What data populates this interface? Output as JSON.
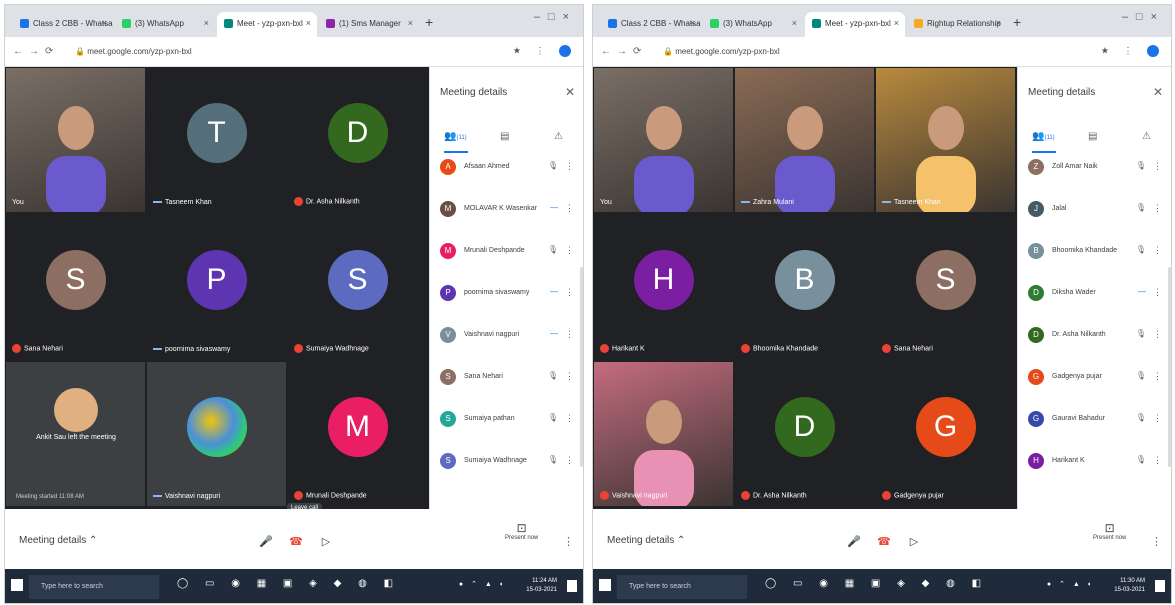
{
  "screens": [
    {
      "id": "left",
      "tabs": [
        {
          "label": "Class 2 CBB - Whatsapp in bl",
          "fav": "#1a73e8",
          "active": false
        },
        {
          "label": "(3) WhatsApp",
          "fav": "#25d366",
          "active": false
        },
        {
          "label": "Meet - yzp-pxn-bxl",
          "fav": "#00897b",
          "active": true
        },
        {
          "label": "(1) Sms Manager",
          "fav": "#8e24aa",
          "active": false
        }
      ],
      "url": "meet.google.com/yzp-pxn-bxl",
      "tiles": [
        {
          "kind": "camera",
          "name": "You",
          "mic": "none",
          "bg": "#7a6f66"
        },
        {
          "kind": "avatar",
          "letter": "T",
          "color": "#546e7a",
          "name": "Tasneem Khan",
          "mic": "on"
        },
        {
          "kind": "avatar",
          "letter": "D",
          "color": "#33691e",
          "name": "Dr. Asha Nilkanth",
          "mic": "off"
        },
        {
          "kind": "avatar",
          "letter": "S",
          "color": "#8d6e63",
          "name": "Sana Nehari",
          "mic": "off"
        },
        {
          "kind": "avatar",
          "letter": "P",
          "color": "#5e35b1",
          "name": "poornima sivaswamy",
          "mic": "on"
        },
        {
          "kind": "avatar",
          "letter": "S",
          "color": "#5c6bc0",
          "name": "Sumaiya Wadhnage",
          "mic": "off"
        },
        {
          "kind": "left",
          "note": "Ankit Sau left the meeting",
          "sub": "Meeting started 11:08 AM",
          "name": "",
          "mic": "on"
        },
        {
          "kind": "image",
          "name": "Vaishnavi nagpuri",
          "mic": "on"
        },
        {
          "kind": "avatar",
          "letter": "M",
          "color": "#e91e63",
          "name": "Mrunali Deshpande",
          "mic": "off"
        }
      ],
      "tooltip": "Leave call",
      "panel": {
        "title": "Meeting details",
        "people_count": "(11)",
        "participants": [
          {
            "name": "Afsaan Ahmed",
            "initial": "A",
            "color": "#e64a19",
            "mic": "off"
          },
          {
            "name": "MOLAVAR K Wasenkar",
            "initial": "M",
            "color": "#6d4c41",
            "mic": "on"
          },
          {
            "name": "Mrunali Deshpande",
            "initial": "M",
            "color": "#e91e63",
            "mic": "off"
          },
          {
            "name": "poornima sivaswamy",
            "initial": "P",
            "color": "#5e35b1",
            "mic": "on"
          },
          {
            "name": "Vaishnavi nagpuri",
            "initial": "V",
            "color": "#78909c",
            "mic": "on"
          },
          {
            "name": "Sana Nehari",
            "initial": "S",
            "color": "#8d6e63",
            "mic": "off"
          },
          {
            "name": "Sumaiya pathan",
            "initial": "S",
            "color": "#26a69a",
            "mic": "off"
          },
          {
            "name": "Sumaiya Wadhnage",
            "initial": "S",
            "color": "#5c6bc0",
            "mic": "off"
          }
        ]
      },
      "bottom": {
        "meeting_details": "Meeting details",
        "present": "Present now"
      },
      "taskbar": {
        "search": "Type here to search",
        "time": "11:24 AM",
        "date": "15-03-2021"
      }
    },
    {
      "id": "right",
      "tabs": [
        {
          "label": "Class 2 CBB - Whatsapp in bl",
          "fav": "#1a73e8",
          "active": false
        },
        {
          "label": "(3) WhatsApp",
          "fav": "#25d366",
          "active": false
        },
        {
          "label": "Meet - yzp-pxn-bxl",
          "fav": "#00897b",
          "active": true
        },
        {
          "label": "Rightup Relationship",
          "fav": "#f9a825",
          "active": false
        }
      ],
      "url": "meet.google.com/yzp-pxn-bxl",
      "tiles": [
        {
          "kind": "camera",
          "name": "You",
          "mic": "none",
          "bg": "#7a6f66"
        },
        {
          "kind": "camera2",
          "name": "Zahra Mulani",
          "mic": "on",
          "bg": "#8a6b55"
        },
        {
          "kind": "camera3",
          "name": "Tasneem Khan",
          "mic": "on",
          "bg": "#b88a3d"
        },
        {
          "kind": "avatar",
          "letter": "H",
          "color": "#7b1fa2",
          "name": "Harikant K",
          "mic": "off"
        },
        {
          "kind": "avatar",
          "letter": "B",
          "color": "#78909c",
          "name": "Bhoomika Khandade",
          "mic": "off"
        },
        {
          "kind": "avatar",
          "letter": "S",
          "color": "#8d6e63",
          "name": "Sana Nehari",
          "mic": "off"
        },
        {
          "kind": "camera4",
          "name": "Vaishnavi nagpuri",
          "mic": "off",
          "bg": "#c46c7f"
        },
        {
          "kind": "avatar",
          "letter": "D",
          "color": "#33691e",
          "name": "Dr. Asha Nilkanth",
          "mic": "off"
        },
        {
          "kind": "avatar",
          "letter": "G",
          "color": "#e64a19",
          "name": "Gadgenya pujar",
          "mic": "off"
        }
      ],
      "tooltip": "",
      "panel": {
        "title": "Meeting details",
        "people_count": "(11)",
        "participants": [
          {
            "name": "Zoll Amar Naik",
            "initial": "Z",
            "color": "#8d6e63",
            "mic": "off"
          },
          {
            "name": "Jalal",
            "initial": "J",
            "color": "#455a64",
            "mic": "off"
          },
          {
            "name": "Bhoomika Khandade",
            "initial": "B",
            "color": "#78909c",
            "mic": "off"
          },
          {
            "name": "Diksha Wader",
            "initial": "D",
            "color": "#2e7d32",
            "mic": "on"
          },
          {
            "name": "Dr. Asha Nilkanth",
            "initial": "D",
            "color": "#33691e",
            "mic": "off"
          },
          {
            "name": "Gadgenya pujar",
            "initial": "G",
            "color": "#e64a19",
            "mic": "off"
          },
          {
            "name": "Gauravi Bahadur",
            "initial": "G",
            "color": "#3949ab",
            "mic": "off"
          },
          {
            "name": "Harikant K",
            "initial": "H",
            "color": "#7b1fa2",
            "mic": "off"
          }
        ]
      },
      "bottom": {
        "meeting_details": "Meeting details",
        "present": "Present now"
      },
      "taskbar": {
        "search": "Type here to search",
        "time": "11:30 AM",
        "date": "15-03-2021"
      }
    }
  ]
}
